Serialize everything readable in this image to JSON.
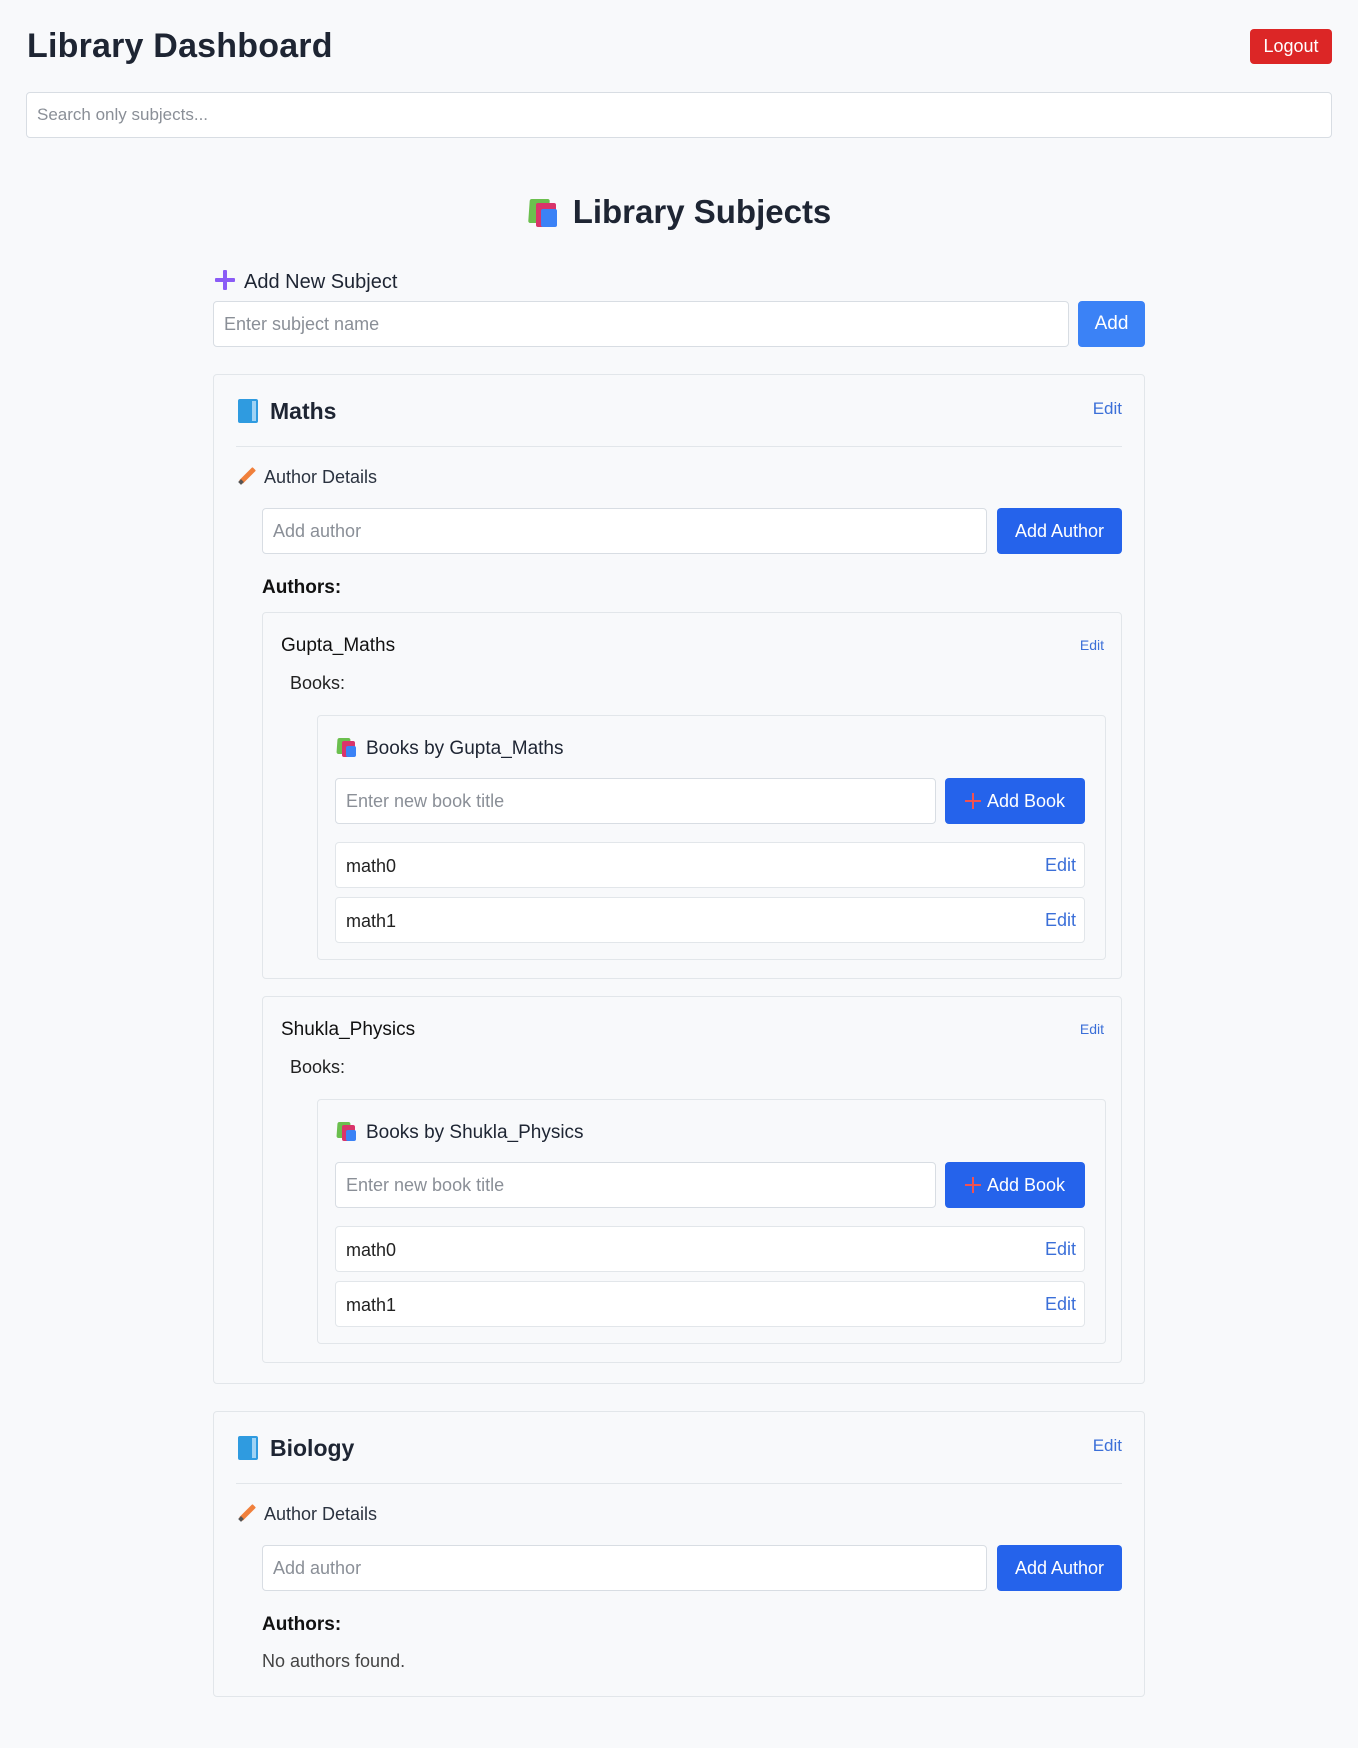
{
  "header": {
    "title": "Library Dashboard",
    "logout_label": "Logout"
  },
  "search": {
    "placeholder": "Search only subjects..."
  },
  "main": {
    "title": "Library Subjects",
    "add_subject": {
      "label": "Add New Subject",
      "placeholder": "Enter subject name",
      "button": "Add"
    }
  },
  "colors": {
    "primary": "#2563eb",
    "danger": "#dc2626",
    "link": "#3b6fd8",
    "accent_purple": "#8b5cf6"
  },
  "subjects": [
    {
      "name": "Maths",
      "edit": "Edit",
      "author_details_label": "Author Details",
      "author_placeholder": "Add author",
      "add_author_button": "Add Author",
      "authors_label": "Authors:",
      "authors": [
        {
          "name": "Gupta_Maths",
          "edit": "Edit",
          "books_label": "Books:",
          "books_title": "Books by Gupta_Maths",
          "book_placeholder": "Enter new book title",
          "add_book_button": "Add Book",
          "books": [
            {
              "title": "math0",
              "edit": "Edit"
            },
            {
              "title": "math1",
              "edit": "Edit"
            }
          ]
        },
        {
          "name": "Shukla_Physics",
          "edit": "Edit",
          "books_label": "Books:",
          "books_title": "Books by Shukla_Physics",
          "book_placeholder": "Enter new book title",
          "add_book_button": "Add Book",
          "books": [
            {
              "title": "math0",
              "edit": "Edit"
            },
            {
              "title": "math1",
              "edit": "Edit"
            }
          ]
        }
      ]
    },
    {
      "name": "Biology",
      "edit": "Edit",
      "author_details_label": "Author Details",
      "author_placeholder": "Add author",
      "add_author_button": "Add Author",
      "authors_label": "Authors:",
      "no_authors_text": "No authors found."
    }
  ]
}
